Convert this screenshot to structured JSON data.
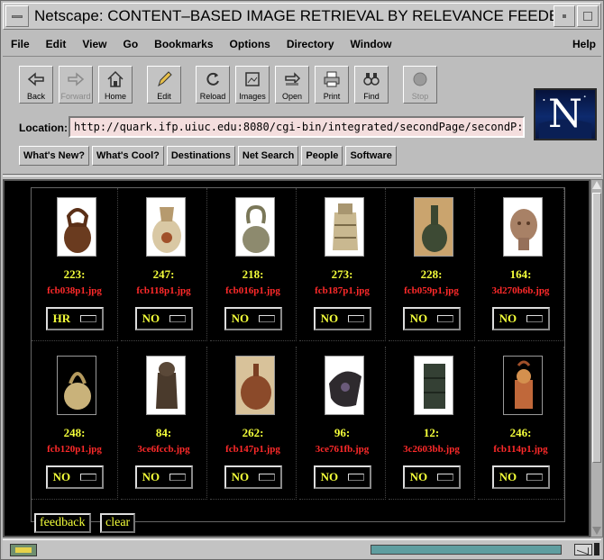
{
  "window": {
    "title": "Netscape: CONTENT–BASED IMAGE RETRIEVAL BY RELEVANCE FEEDB"
  },
  "menu": [
    "File",
    "Edit",
    "View",
    "Go",
    "Bookmarks",
    "Options",
    "Directory",
    "Window"
  ],
  "menu_help": "Help",
  "toolbar": {
    "back": "Back",
    "forward": "Forward",
    "home": "Home",
    "edit": "Edit",
    "reload": "Reload",
    "images": "Images",
    "open": "Open",
    "print": "Print",
    "find": "Find",
    "stop": "Stop"
  },
  "location": {
    "label": "Location:",
    "url": "http://quark.ifp.uiuc.edu:8080/cgi-bin/integrated/secondPage/secondP:"
  },
  "directory_buttons": [
    "What's New?",
    "What's Cool?",
    "Destinations",
    "Net Search",
    "People",
    "Software"
  ],
  "results": [
    {
      "num": "223:",
      "file": "fcb038p1.jpg",
      "feedback": "HR"
    },
    {
      "num": "247:",
      "file": "fcb118p1.jpg",
      "feedback": "NO"
    },
    {
      "num": "218:",
      "file": "fcb016p1.jpg",
      "feedback": "NO"
    },
    {
      "num": "273:",
      "file": "fcb187p1.jpg",
      "feedback": "NO"
    },
    {
      "num": "228:",
      "file": "fcb059p1.jpg",
      "feedback": "NO"
    },
    {
      "num": "164:",
      "file": "3d270b6b.jpg",
      "feedback": "NO"
    },
    {
      "num": "248:",
      "file": "fcb120p1.jpg",
      "feedback": "NO"
    },
    {
      "num": "84:",
      "file": "3ce6fccb.jpg",
      "feedback": "NO"
    },
    {
      "num": "262:",
      "file": "fcb147p1.jpg",
      "feedback": "NO"
    },
    {
      "num": "96:",
      "file": "3ce761fb.jpg",
      "feedback": "NO"
    },
    {
      "num": "12:",
      "file": "3c2603bb.jpg",
      "feedback": "NO"
    },
    {
      "num": "246:",
      "file": "fcb114p1.jpg",
      "feedback": "NO"
    }
  ],
  "actions": {
    "feedback": "feedback",
    "clear": "clear"
  }
}
